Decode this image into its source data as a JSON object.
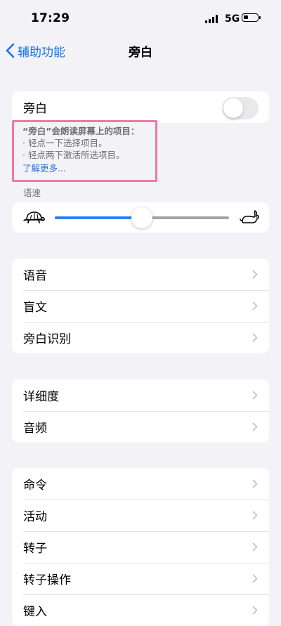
{
  "status": {
    "time": "17:29",
    "network": "5G",
    "battery_level": 0.35
  },
  "nav": {
    "back_label": "辅助功能",
    "title": "旁白"
  },
  "voiceover": {
    "label": "旁白",
    "enabled": false,
    "description": {
      "heading": "“旁白”会朗读屏幕上的项目：",
      "bullets": [
        "·  轻点一下选择项目。",
        "·  轻点两下激活所选项目。"
      ],
      "learn_more": "了解更多..."
    }
  },
  "speech_rate": {
    "label": "语速",
    "value": 0.5,
    "slow_icon": "turtle-icon",
    "fast_icon": "rabbit-icon"
  },
  "groups": [
    {
      "items": [
        {
          "label": "语音"
        },
        {
          "label": "盲文"
        },
        {
          "label": "旁白识别"
        }
      ]
    },
    {
      "items": [
        {
          "label": "详细度"
        },
        {
          "label": "音频"
        }
      ]
    },
    {
      "items": [
        {
          "label": "命令"
        },
        {
          "label": "活动"
        },
        {
          "label": "转子"
        },
        {
          "label": "转子操作"
        },
        {
          "label": "键入"
        }
      ]
    }
  ],
  "colors": {
    "accent": "#2f7cf6",
    "highlight_border": "#f0779f",
    "background": "#f2f2f7"
  }
}
